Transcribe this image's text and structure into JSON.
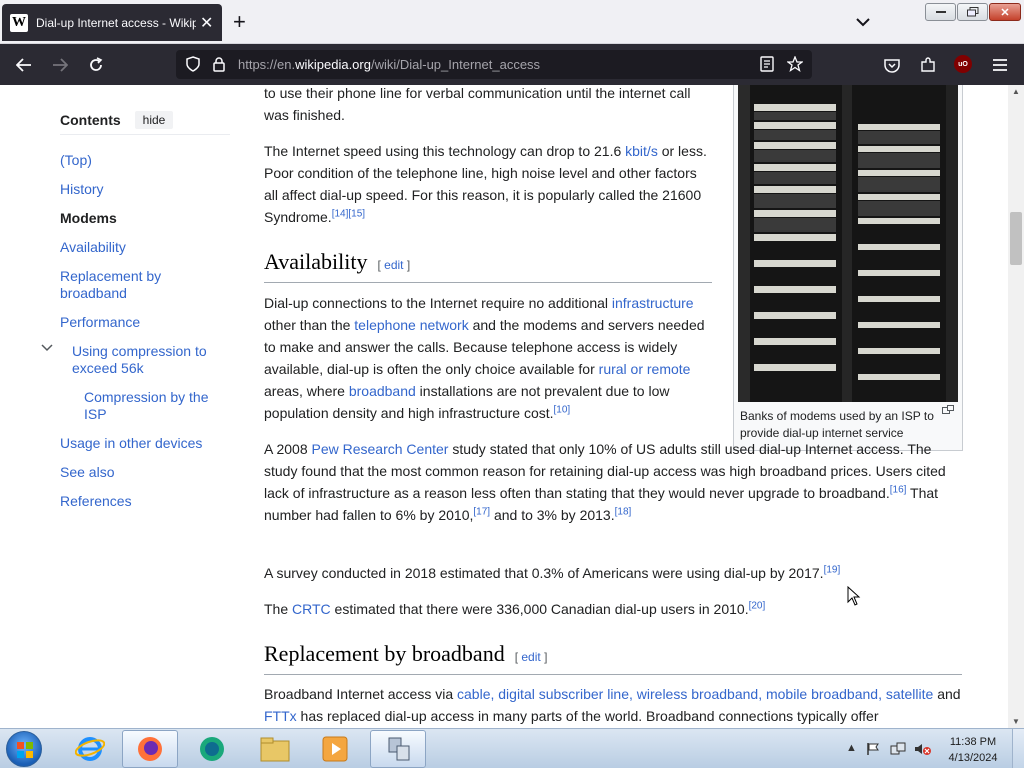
{
  "browser": {
    "tab_title": "Dial-up Internet access - Wikipedia",
    "favicon_letter": "W",
    "url_prefix": "https://en.",
    "url_domain": "wikipedia.org",
    "url_path": "/wiki/Dial-up_Internet_access",
    "ublock_label": "uO"
  },
  "toc": {
    "title": "Contents",
    "hide_label": "hide",
    "items": [
      {
        "label": "(Top)"
      },
      {
        "label": "History"
      },
      {
        "label": "Modems"
      },
      {
        "label": "Availability"
      },
      {
        "label": "Replacement by broadband"
      },
      {
        "label": "Performance"
      },
      {
        "label": "Using compression to exceed 56k"
      },
      {
        "label": "Compression by the ISP"
      },
      {
        "label": "Usage in other devices"
      },
      {
        "label": "See also"
      },
      {
        "label": "References"
      }
    ]
  },
  "article": {
    "p_top_text": "to use their phone line for verbal communication until the internet call was finished.",
    "p_speed": {
      "t1": "The Internet speed using this technology can drop to 21.6 ",
      "link1": "kbit/s",
      "t2": " or less. Poor condition of the telephone line, high noise level and other factors all affect dial-up speed. For this reason, it is popularly called the 21600 Syndrome.",
      "ref1": "[14]",
      "ref2": "[15]"
    },
    "h_availability": "Availability",
    "h_replacement": "Replacement by broadband",
    "edit_open": "[ ",
    "edit_label": "edit",
    "edit_close": " ]",
    "p_avail": {
      "t1": "Dial-up connections to the Internet require no additional ",
      "link1": "infrastructure",
      "t2": " other than the ",
      "link2": "telephone network",
      "t3": " and the modems and servers needed to make and answer the calls. Because telephone access is widely available, dial-up is often the only choice available for ",
      "link3": "rural or remote",
      "t4": " areas, where ",
      "link4": "broadband",
      "t5": " installations are not prevalent due to low population density and high infrastructure cost.",
      "ref1": "[10]"
    },
    "p_pew": {
      "t1": "A 2008 ",
      "link1": "Pew Research Center",
      "t2": " study stated that only 10% of US adults still used dial-up Internet access. The study found that the most common reason for retaining dial-up access was high broadband prices. Users cited lack of infrastructure as a reason less often than stating that they would never upgrade to broadband.",
      "ref1": "[16]",
      "t3": " That number had fallen to 6% by 2010,",
      "ref2": "[17]",
      "t4": " and to 3% by 2013.",
      "ref3": "[18]"
    },
    "p_survey": {
      "t1": "A survey conducted in 2018 estimated that 0.3% of Americans were using dial-up by 2017.",
      "ref1": "[19]"
    },
    "p_crtc": {
      "t1": "The ",
      "link1": "CRTC",
      "t2": " estimated that there were 336,000 Canadian dial-up users in 2010.",
      "ref1": "[20]"
    },
    "p_bb": {
      "t1": "Broadband Internet access via ",
      "link1": "cable",
      "sep1": ", ",
      "link2": "digital subscriber line",
      "sep2": ", ",
      "link3": "wireless broadband",
      "sep3": ", ",
      "link4": "mobile broadband",
      "sep4": ", ",
      "link5": "satellite",
      "t2": " and ",
      "link6": "FTTx",
      "t3": " has replaced dial-up access in many parts of the world. Broadband connections typically offer"
    },
    "figure_caption": "Banks of modems used by an ISP to provide dial-up internet service"
  },
  "taskbar": {
    "time": "11:38 PM",
    "date": "4/13/2024"
  },
  "colors": {
    "link": "#3366cc",
    "chrome_dark": "#2b2a33",
    "taskbar": "#c8d8ea"
  }
}
